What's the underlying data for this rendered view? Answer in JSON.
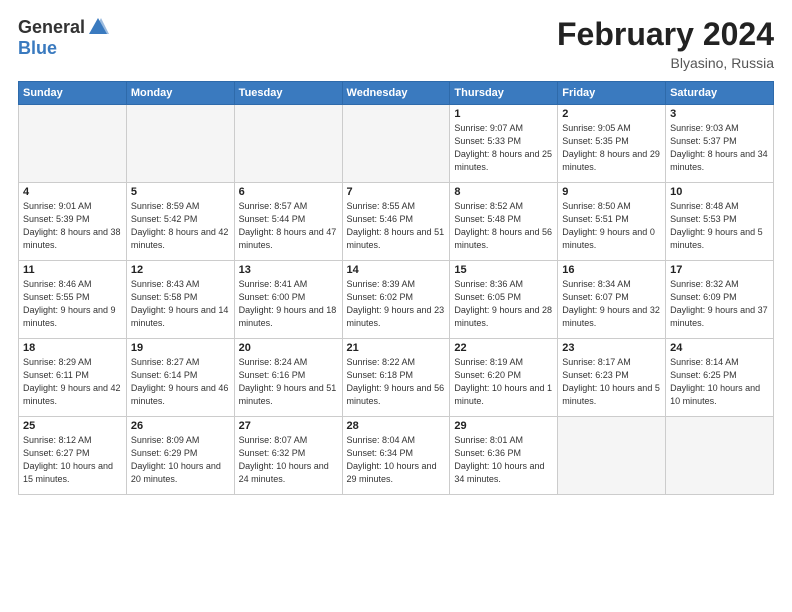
{
  "logo": {
    "general": "General",
    "blue": "Blue"
  },
  "title": {
    "month": "February 2024",
    "location": "Blyasino, Russia"
  },
  "weekdays": [
    "Sunday",
    "Monday",
    "Tuesday",
    "Wednesday",
    "Thursday",
    "Friday",
    "Saturday"
  ],
  "rows": [
    [
      {
        "num": "",
        "info": "",
        "empty": true
      },
      {
        "num": "",
        "info": "",
        "empty": true
      },
      {
        "num": "",
        "info": "",
        "empty": true
      },
      {
        "num": "",
        "info": "",
        "empty": true
      },
      {
        "num": "1",
        "info": "Sunrise: 9:07 AM\nSunset: 5:33 PM\nDaylight: 8 hours\nand 25 minutes."
      },
      {
        "num": "2",
        "info": "Sunrise: 9:05 AM\nSunset: 5:35 PM\nDaylight: 8 hours\nand 29 minutes."
      },
      {
        "num": "3",
        "info": "Sunrise: 9:03 AM\nSunset: 5:37 PM\nDaylight: 8 hours\nand 34 minutes."
      }
    ],
    [
      {
        "num": "4",
        "info": "Sunrise: 9:01 AM\nSunset: 5:39 PM\nDaylight: 8 hours\nand 38 minutes."
      },
      {
        "num": "5",
        "info": "Sunrise: 8:59 AM\nSunset: 5:42 PM\nDaylight: 8 hours\nand 42 minutes."
      },
      {
        "num": "6",
        "info": "Sunrise: 8:57 AM\nSunset: 5:44 PM\nDaylight: 8 hours\nand 47 minutes."
      },
      {
        "num": "7",
        "info": "Sunrise: 8:55 AM\nSunset: 5:46 PM\nDaylight: 8 hours\nand 51 minutes."
      },
      {
        "num": "8",
        "info": "Sunrise: 8:52 AM\nSunset: 5:48 PM\nDaylight: 8 hours\nand 56 minutes."
      },
      {
        "num": "9",
        "info": "Sunrise: 8:50 AM\nSunset: 5:51 PM\nDaylight: 9 hours\nand 0 minutes."
      },
      {
        "num": "10",
        "info": "Sunrise: 8:48 AM\nSunset: 5:53 PM\nDaylight: 9 hours\nand 5 minutes."
      }
    ],
    [
      {
        "num": "11",
        "info": "Sunrise: 8:46 AM\nSunset: 5:55 PM\nDaylight: 9 hours\nand 9 minutes."
      },
      {
        "num": "12",
        "info": "Sunrise: 8:43 AM\nSunset: 5:58 PM\nDaylight: 9 hours\nand 14 minutes."
      },
      {
        "num": "13",
        "info": "Sunrise: 8:41 AM\nSunset: 6:00 PM\nDaylight: 9 hours\nand 18 minutes."
      },
      {
        "num": "14",
        "info": "Sunrise: 8:39 AM\nSunset: 6:02 PM\nDaylight: 9 hours\nand 23 minutes."
      },
      {
        "num": "15",
        "info": "Sunrise: 8:36 AM\nSunset: 6:05 PM\nDaylight: 9 hours\nand 28 minutes."
      },
      {
        "num": "16",
        "info": "Sunrise: 8:34 AM\nSunset: 6:07 PM\nDaylight: 9 hours\nand 32 minutes."
      },
      {
        "num": "17",
        "info": "Sunrise: 8:32 AM\nSunset: 6:09 PM\nDaylight: 9 hours\nand 37 minutes."
      }
    ],
    [
      {
        "num": "18",
        "info": "Sunrise: 8:29 AM\nSunset: 6:11 PM\nDaylight: 9 hours\nand 42 minutes."
      },
      {
        "num": "19",
        "info": "Sunrise: 8:27 AM\nSunset: 6:14 PM\nDaylight: 9 hours\nand 46 minutes."
      },
      {
        "num": "20",
        "info": "Sunrise: 8:24 AM\nSunset: 6:16 PM\nDaylight: 9 hours\nand 51 minutes."
      },
      {
        "num": "21",
        "info": "Sunrise: 8:22 AM\nSunset: 6:18 PM\nDaylight: 9 hours\nand 56 minutes."
      },
      {
        "num": "22",
        "info": "Sunrise: 8:19 AM\nSunset: 6:20 PM\nDaylight: 10 hours\nand 1 minute."
      },
      {
        "num": "23",
        "info": "Sunrise: 8:17 AM\nSunset: 6:23 PM\nDaylight: 10 hours\nand 5 minutes."
      },
      {
        "num": "24",
        "info": "Sunrise: 8:14 AM\nSunset: 6:25 PM\nDaylight: 10 hours\nand 10 minutes."
      }
    ],
    [
      {
        "num": "25",
        "info": "Sunrise: 8:12 AM\nSunset: 6:27 PM\nDaylight: 10 hours\nand 15 minutes."
      },
      {
        "num": "26",
        "info": "Sunrise: 8:09 AM\nSunset: 6:29 PM\nDaylight: 10 hours\nand 20 minutes."
      },
      {
        "num": "27",
        "info": "Sunrise: 8:07 AM\nSunset: 6:32 PM\nDaylight: 10 hours\nand 24 minutes."
      },
      {
        "num": "28",
        "info": "Sunrise: 8:04 AM\nSunset: 6:34 PM\nDaylight: 10 hours\nand 29 minutes."
      },
      {
        "num": "29",
        "info": "Sunrise: 8:01 AM\nSunset: 6:36 PM\nDaylight: 10 hours\nand 34 minutes."
      },
      {
        "num": "",
        "info": "",
        "empty": true
      },
      {
        "num": "",
        "info": "",
        "empty": true
      }
    ]
  ]
}
